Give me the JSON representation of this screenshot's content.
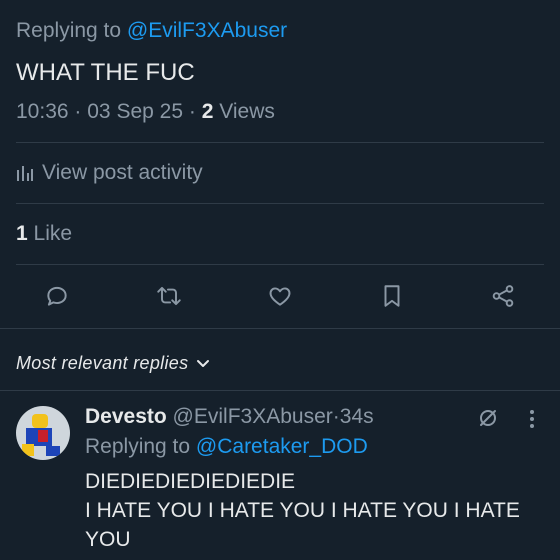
{
  "post": {
    "replying_prefix": "Replying to",
    "replying_handle": "@EvilF3XAbuser",
    "text": "WHAT THE FUC",
    "time": "10:36",
    "sep": "·",
    "date": "03 Sep 25",
    "views_count": "2",
    "views_label": "Views",
    "activity_label": "View post activity",
    "likes_count": "1",
    "likes_label": "Like"
  },
  "actions": {
    "icons": [
      "reply-icon",
      "retweet-icon",
      "like-icon",
      "bookmark-icon",
      "share-icon"
    ]
  },
  "replies_section": {
    "sort_label": "Most relevant replies"
  },
  "reply": {
    "name": "Devesto",
    "handle": "@EvilF3XAbuser",
    "sep": "·",
    "time": "34s",
    "replying_prefix": "Replying to",
    "replying_handle": "@Caretaker_DOD",
    "text_line1": "DIEDIEDIEDIEDIEDIE",
    "text_line2": "I HATE YOU I HATE YOU I HATE YOU I HATE",
    "text_line3": "YOU"
  },
  "colors": {
    "background": "#15202b",
    "text": "#e7e9ea",
    "muted": "#8b98a5",
    "link": "#1d9bf0",
    "divider": "#2f3b47"
  }
}
